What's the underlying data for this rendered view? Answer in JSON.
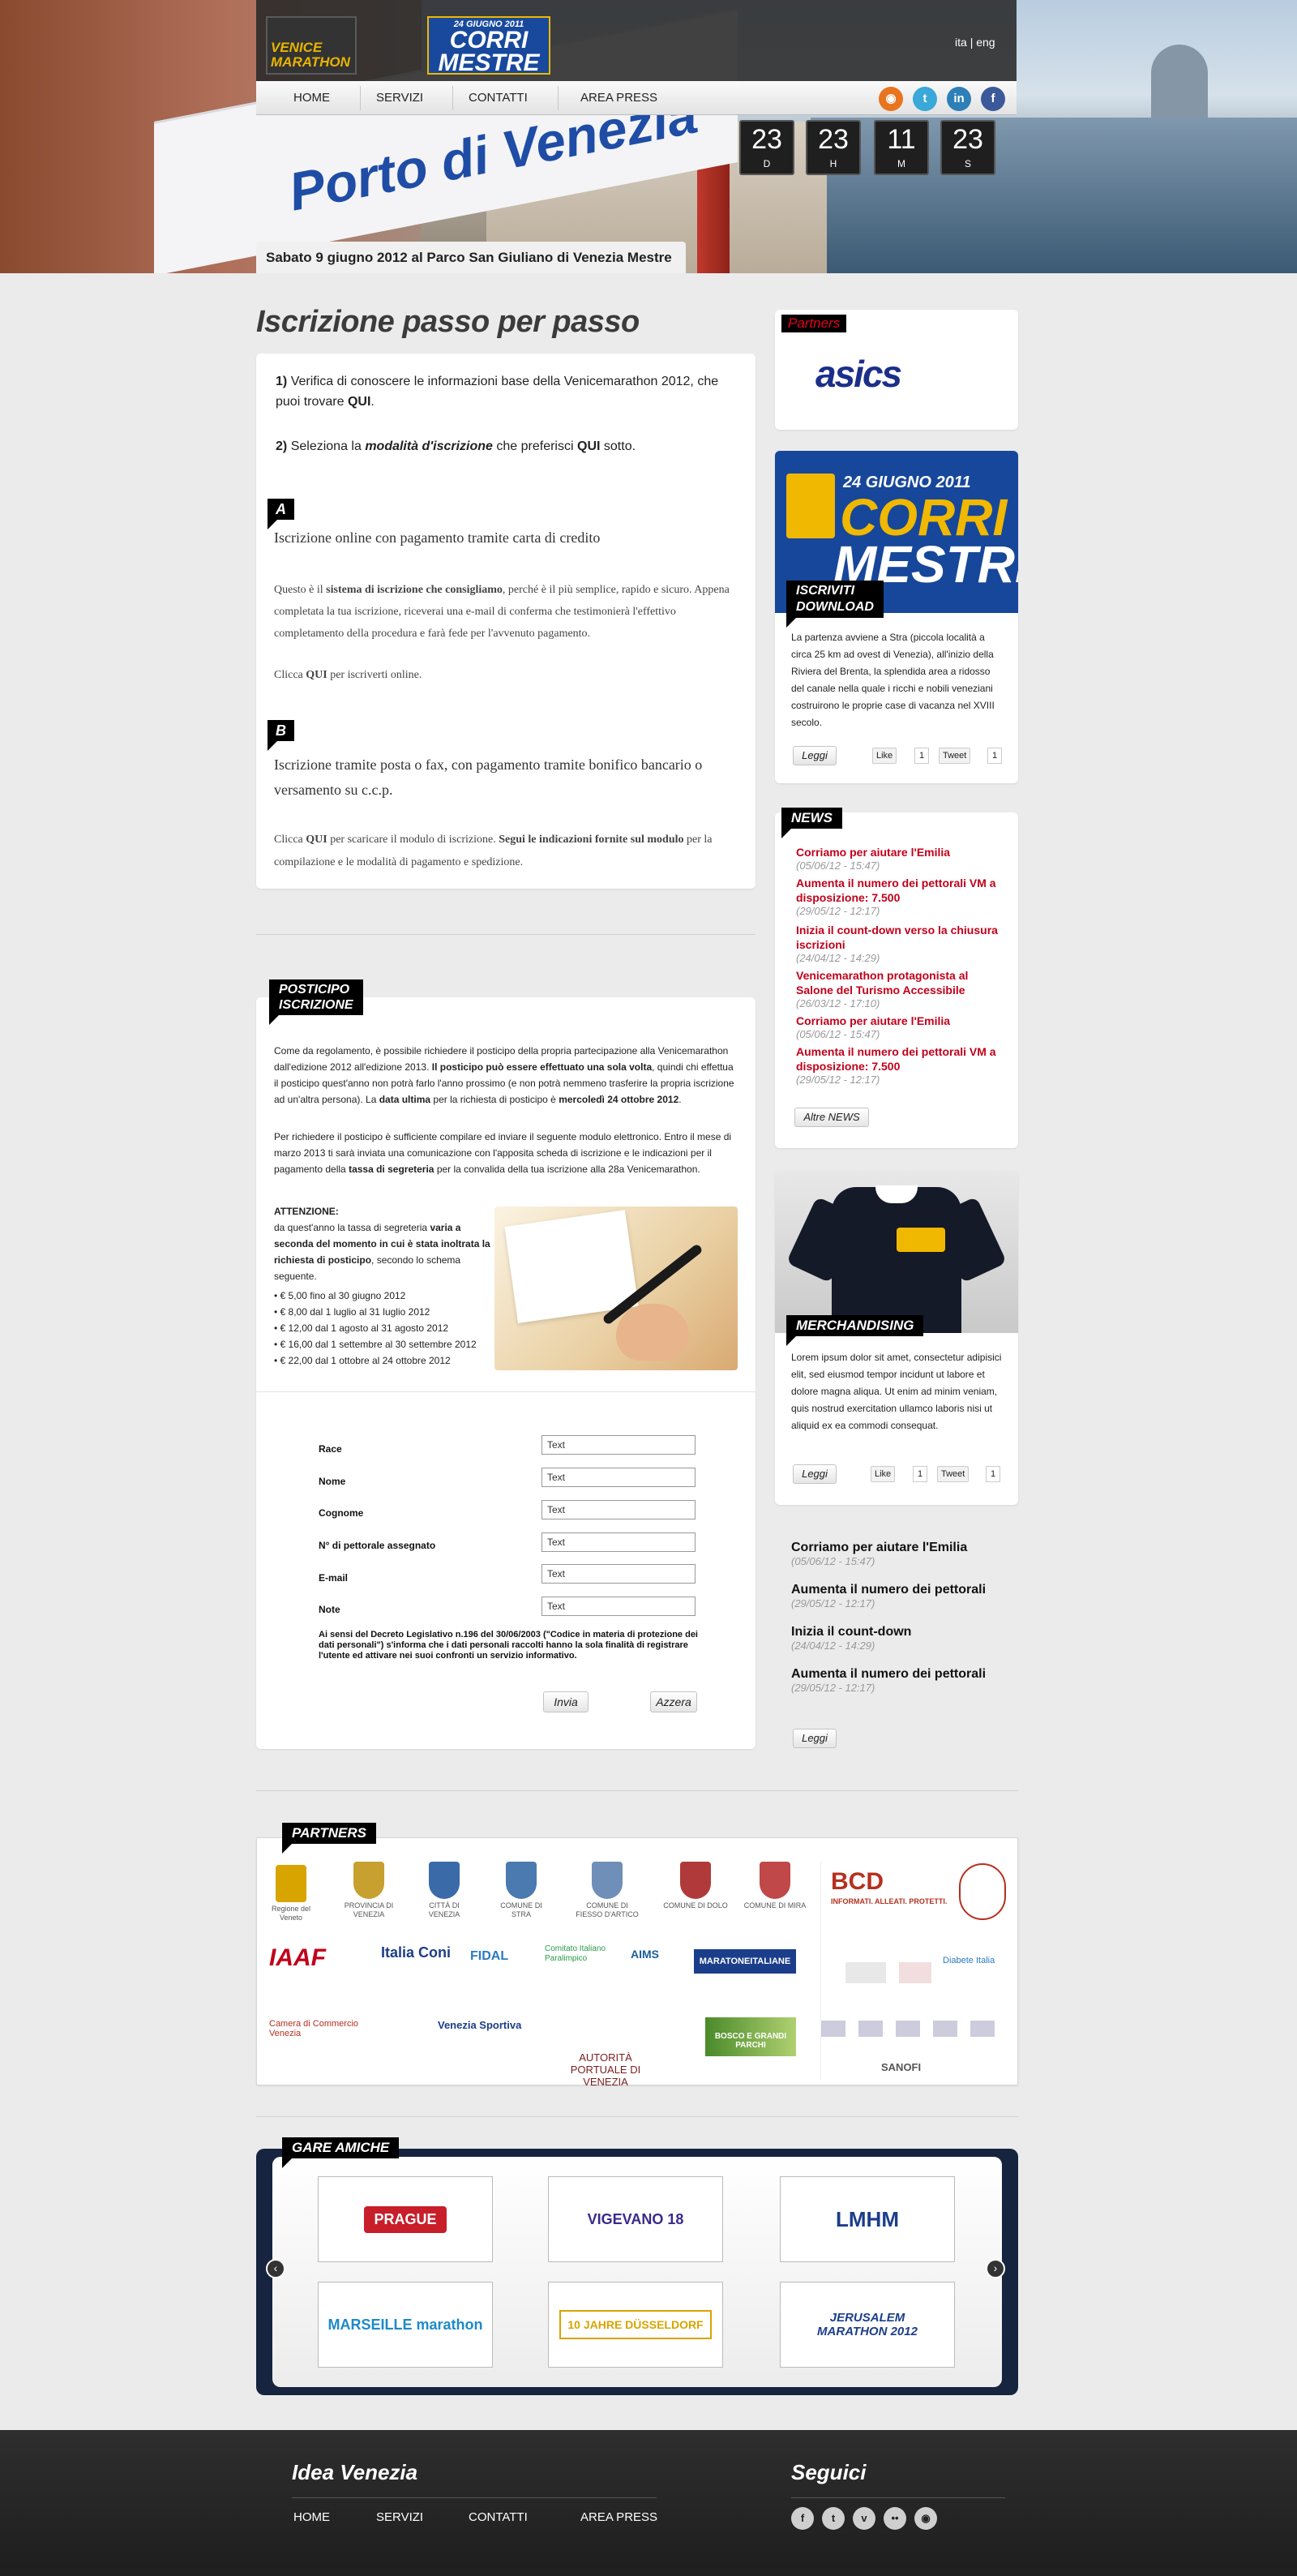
{
  "header": {
    "logo_venice": "VENICE MARATHON",
    "logo_corri_date": "24 GIUGNO 2011",
    "logo_corri_title_1": "CORRI",
    "logo_corri_title_2": "MESTRE",
    "lang_ita": "ita",
    "lang_sep": "|",
    "lang_eng": "eng",
    "hero_banner_text": "Porto di Venezia",
    "caption": "Sabato 9 giugno 2012 al Parco San Giuliano di Venezia Mestre"
  },
  "nav": {
    "home": "HOME",
    "servizi": "SERVIZI",
    "contatti": "CONTATTI",
    "area_press": "AREA PRESS"
  },
  "social_icons": [
    "rss-icon",
    "twitter-icon",
    "linkedin-icon",
    "facebook-icon"
  ],
  "countdown": [
    {
      "value": "23",
      "unit": "D"
    },
    {
      "value": "23",
      "unit": "H"
    },
    {
      "value": "11",
      "unit": "M"
    },
    {
      "value": "23",
      "unit": "S"
    }
  ],
  "main": {
    "title": "Iscrizione passo per passo",
    "step1_num": "1)",
    "step1_text": "Verifica di conoscere le informazioni base della Venicemarathon 2012, che puoi trovare",
    "step1_link": "QUI",
    "step2_num": "2)",
    "step2_a": "Seleziona la",
    "step2_em": "modalità d'iscrizione",
    "step2_b": "che preferisci",
    "step2_link": "QUI",
    "step2_c": "sotto.",
    "sectionA": {
      "tag": "A",
      "title": "Iscrizione online con pagamento tramite carta di credito",
      "p1_a": "Questo è il",
      "p1_b": "sistema di iscrizione che consigliamo",
      "p1_c": ", perché è il più semplice, rapido e sicuro. Appena completata la tua iscrizione, riceverai una e-mail di conferma che testimonierà l'effettivo completamento della procedura e farà fede per l'avvenuto pagamento.",
      "p2_a": "Clicca",
      "p2_link": "QUI",
      "p2_b": "per iscriverti online."
    },
    "sectionB": {
      "tag": "B",
      "title": "Iscrizione tramite posta o fax, con pagamento tramite bonifico bancario o versamento su c.c.p.",
      "p1_a": "Clicca",
      "p1_link": "QUI",
      "p1_b": "per scaricare il modulo di iscrizione.",
      "p1_c": "Segui le indicazioni fornite sul modulo",
      "p1_d": "per la compilazione e le modalità di pagamento e spedizione."
    }
  },
  "posticipo": {
    "tag1": "POSTICIPO",
    "tag2": "ISCRIZIONE",
    "p1_a": "Come da regolamento, è possibile richiedere il posticipo della propria partecipazione alla Venicemarathon dall'edizione 2012 all'edizione 2013.",
    "p1_b": "Il posticipo può essere effettuato una sola volta",
    "p1_c": ", quindi chi effettua il posticipo quest'anno non potrà farlo l'anno prossimo (e non potrà nemmeno trasferire la propria iscrizione ad un'altra persona). La",
    "p1_d": "data ultima",
    "p1_e": "per la richiesta di posticipo è",
    "p1_f": "mercoledì 24 ottobre 2012",
    "p1_g": ".",
    "p2_a": "Per richiedere il posticipo è sufficiente compilare ed inviare il seguente modulo elettronico. Entro il mese di marzo 2013 ti sarà inviata una comunicazione con l'apposita scheda di iscrizione e le indicazioni per il pagamento della",
    "p2_b": "tassa di segreteria",
    "p2_c": "per la convalida della tua iscrizione alla 28a Venicemarathon.",
    "att_title": "ATTENZIONE:",
    "att_a": "da quest'anno la tassa di segreteria",
    "att_b": "varia a seconda del momento in cui è stata inoltrata la richiesta di posticipo",
    "att_c": ", secondo lo schema seguente.",
    "fees": [
      "• € 5,00 fino al 30 giugno 2012",
      "• € 8,00 dal 1 luglio al 31 luglio 2012",
      "• € 12,00 dal 1 agosto al 31 agosto 2012",
      "• € 16,00 dal 1 settembre al 30 settembre 2012",
      "• € 22,00 dal 1 ottobre al 24 ottobre 2012"
    ]
  },
  "form": {
    "fields": [
      {
        "label": "Race",
        "value": "Text"
      },
      {
        "label": "Nome",
        "value": "Text"
      },
      {
        "label": "Cognome",
        "value": "Text"
      },
      {
        "label": "N° di pettorale assegnato",
        "value": "Text"
      },
      {
        "label": "E-mail",
        "value": "Text"
      },
      {
        "label": "Note",
        "value": "Text"
      }
    ],
    "privacy": "Ai sensi del Decreto Legislativo n.196 del 30/06/2003 (\"Codice in materia di protezione dei dati personali\") s'informa che i dati personali raccolti hanno la sola finalità di registrare l'utente ed attivare nei suoi confronti un servizio informativo.",
    "submit": "Invia",
    "reset": "Azzera"
  },
  "sidebar": {
    "partners_tag": "Partners",
    "asics": "asics",
    "corri_date": "24 GIUGNO 2011",
    "corri_title_1": "CORRI",
    "corri_title_2": "MESTRE",
    "iscriviti_1": "ISCRIVITI",
    "iscriviti_2": "DOWNLOAD",
    "corri_text": "La partenza avviene a Stra (piccola località a circa 25 km ad ovest di Venezia), all'inizio della Riviera del Brenta, la splendida area a ridosso del canale nella quale i ricchi e nobili veneziani costruirono le proprie case di vacanza nel XVIII secolo.",
    "leggi": "Leggi",
    "like": "Like",
    "like_count": "1",
    "tweet": "Tweet",
    "tweet_count": "1",
    "news_tag": "NEWS",
    "news": [
      {
        "title": "Corriamo per aiutare l'Emilia",
        "date": "(05/06/12 - 15:47)"
      },
      {
        "title": "Aumenta il numero dei pettorali VM a disposizione: 7.500",
        "date": "(29/05/12 - 12:17)"
      },
      {
        "title": "Inizia il count-down verso la chiusura iscrizioni",
        "date": "(24/04/12 - 14:29)"
      },
      {
        "title": "Venicemarathon protagonista al Salone del Turismo Accessibile",
        "date": "(26/03/12 - 17:10)"
      },
      {
        "title": "Corriamo per aiutare l'Emilia",
        "date": "(05/06/12 - 15:47)"
      },
      {
        "title": "Aumenta il numero dei pettorali VM a disposizione: 7.500",
        "date": "(29/05/12 - 12:17)"
      }
    ],
    "altre_news": "Altre NEWS",
    "merch_tag": "MERCHANDISING",
    "merch_text": "Lorem ipsum dolor sit amet, consectetur adipisici elit, sed eiusmod tempor incidunt ut labore et dolore magna aliqua. Ut enim ad minim veniam, quis nostrud exercitation ullamco laboris nisi ut aliquid ex ea commodi consequat.",
    "side_news": [
      {
        "title": "Corriamo per aiutare l'Emilia",
        "date": "(05/06/12 - 15:47)"
      },
      {
        "title": "Aumenta il numero dei pettorali",
        "date": "(29/05/12 - 12:17)"
      },
      {
        "title": "Inizia il count-down",
        "date": "(24/04/12 - 14:29)"
      },
      {
        "title": "Aumenta il numero dei pettorali",
        "date": "(29/05/12 - 12:17)"
      }
    ]
  },
  "partners": {
    "tag": "PARTNERS",
    "row1": [
      {
        "label": "Regione del Veneto",
        "color": "#d8a400"
      },
      {
        "label": "PROVINCIA DI VENEZIA",
        "color": "#c8a030"
      },
      {
        "label": "CITTÀ DI VENEZIA",
        "color": "#3a6aa8"
      },
      {
        "label": "COMUNE DI STRA",
        "color": "#4a7ab0"
      },
      {
        "label": "COMUNE DI FIESSO D'ARTICO",
        "color": "#6f8fb8"
      },
      {
        "label": "COMUNE DI DOLO",
        "color": "#b03a3a"
      },
      {
        "label": "COMUNE DI MIRA",
        "color": "#c04848"
      }
    ],
    "bcd": "BCD",
    "bcd_sub": "INFORMATI. ALLEATI. PROTETTI.",
    "row2": [
      "IAAF",
      "Italia Coni",
      "FIDAL",
      "Comitato Italiano Paralimpico",
      "AIMS",
      "MARATONEITALIANE"
    ],
    "row3": [
      "Camera di Commercio Venezia",
      "Venezia Sportiva",
      "AUTORITÀ PORTUALE DI VENEZIA",
      "BOSCO E GRANDI PARCHI"
    ],
    "diabete": "Diabete Italia",
    "sanofi": "SANOFI"
  },
  "gare": {
    "tag": "GARE AMICHE",
    "items": [
      "PRAGUE",
      "VIGEVANO 18",
      "LMHM",
      "MARSEILLE marathon",
      "10 JAHRE DÜSSELDORF",
      "JERUSALEM MARATHON 2012"
    ],
    "prev_icon": "chevron-left-icon",
    "next_icon": "chevron-right-icon"
  },
  "footer": {
    "brand": "Idea Venezia",
    "seguici": "Seguici",
    "nav": [
      "HOME",
      "SERVIZI",
      "CONTATTI",
      "AREA PRESS"
    ],
    "social_icons": [
      "facebook-icon",
      "twitter-icon",
      "vimeo-icon",
      "flickr-icon",
      "rss-icon"
    ]
  },
  "colors": {
    "accent_red": "#c0001b",
    "brand_blue": "#18499c",
    "brand_yellow": "#f0b800"
  }
}
